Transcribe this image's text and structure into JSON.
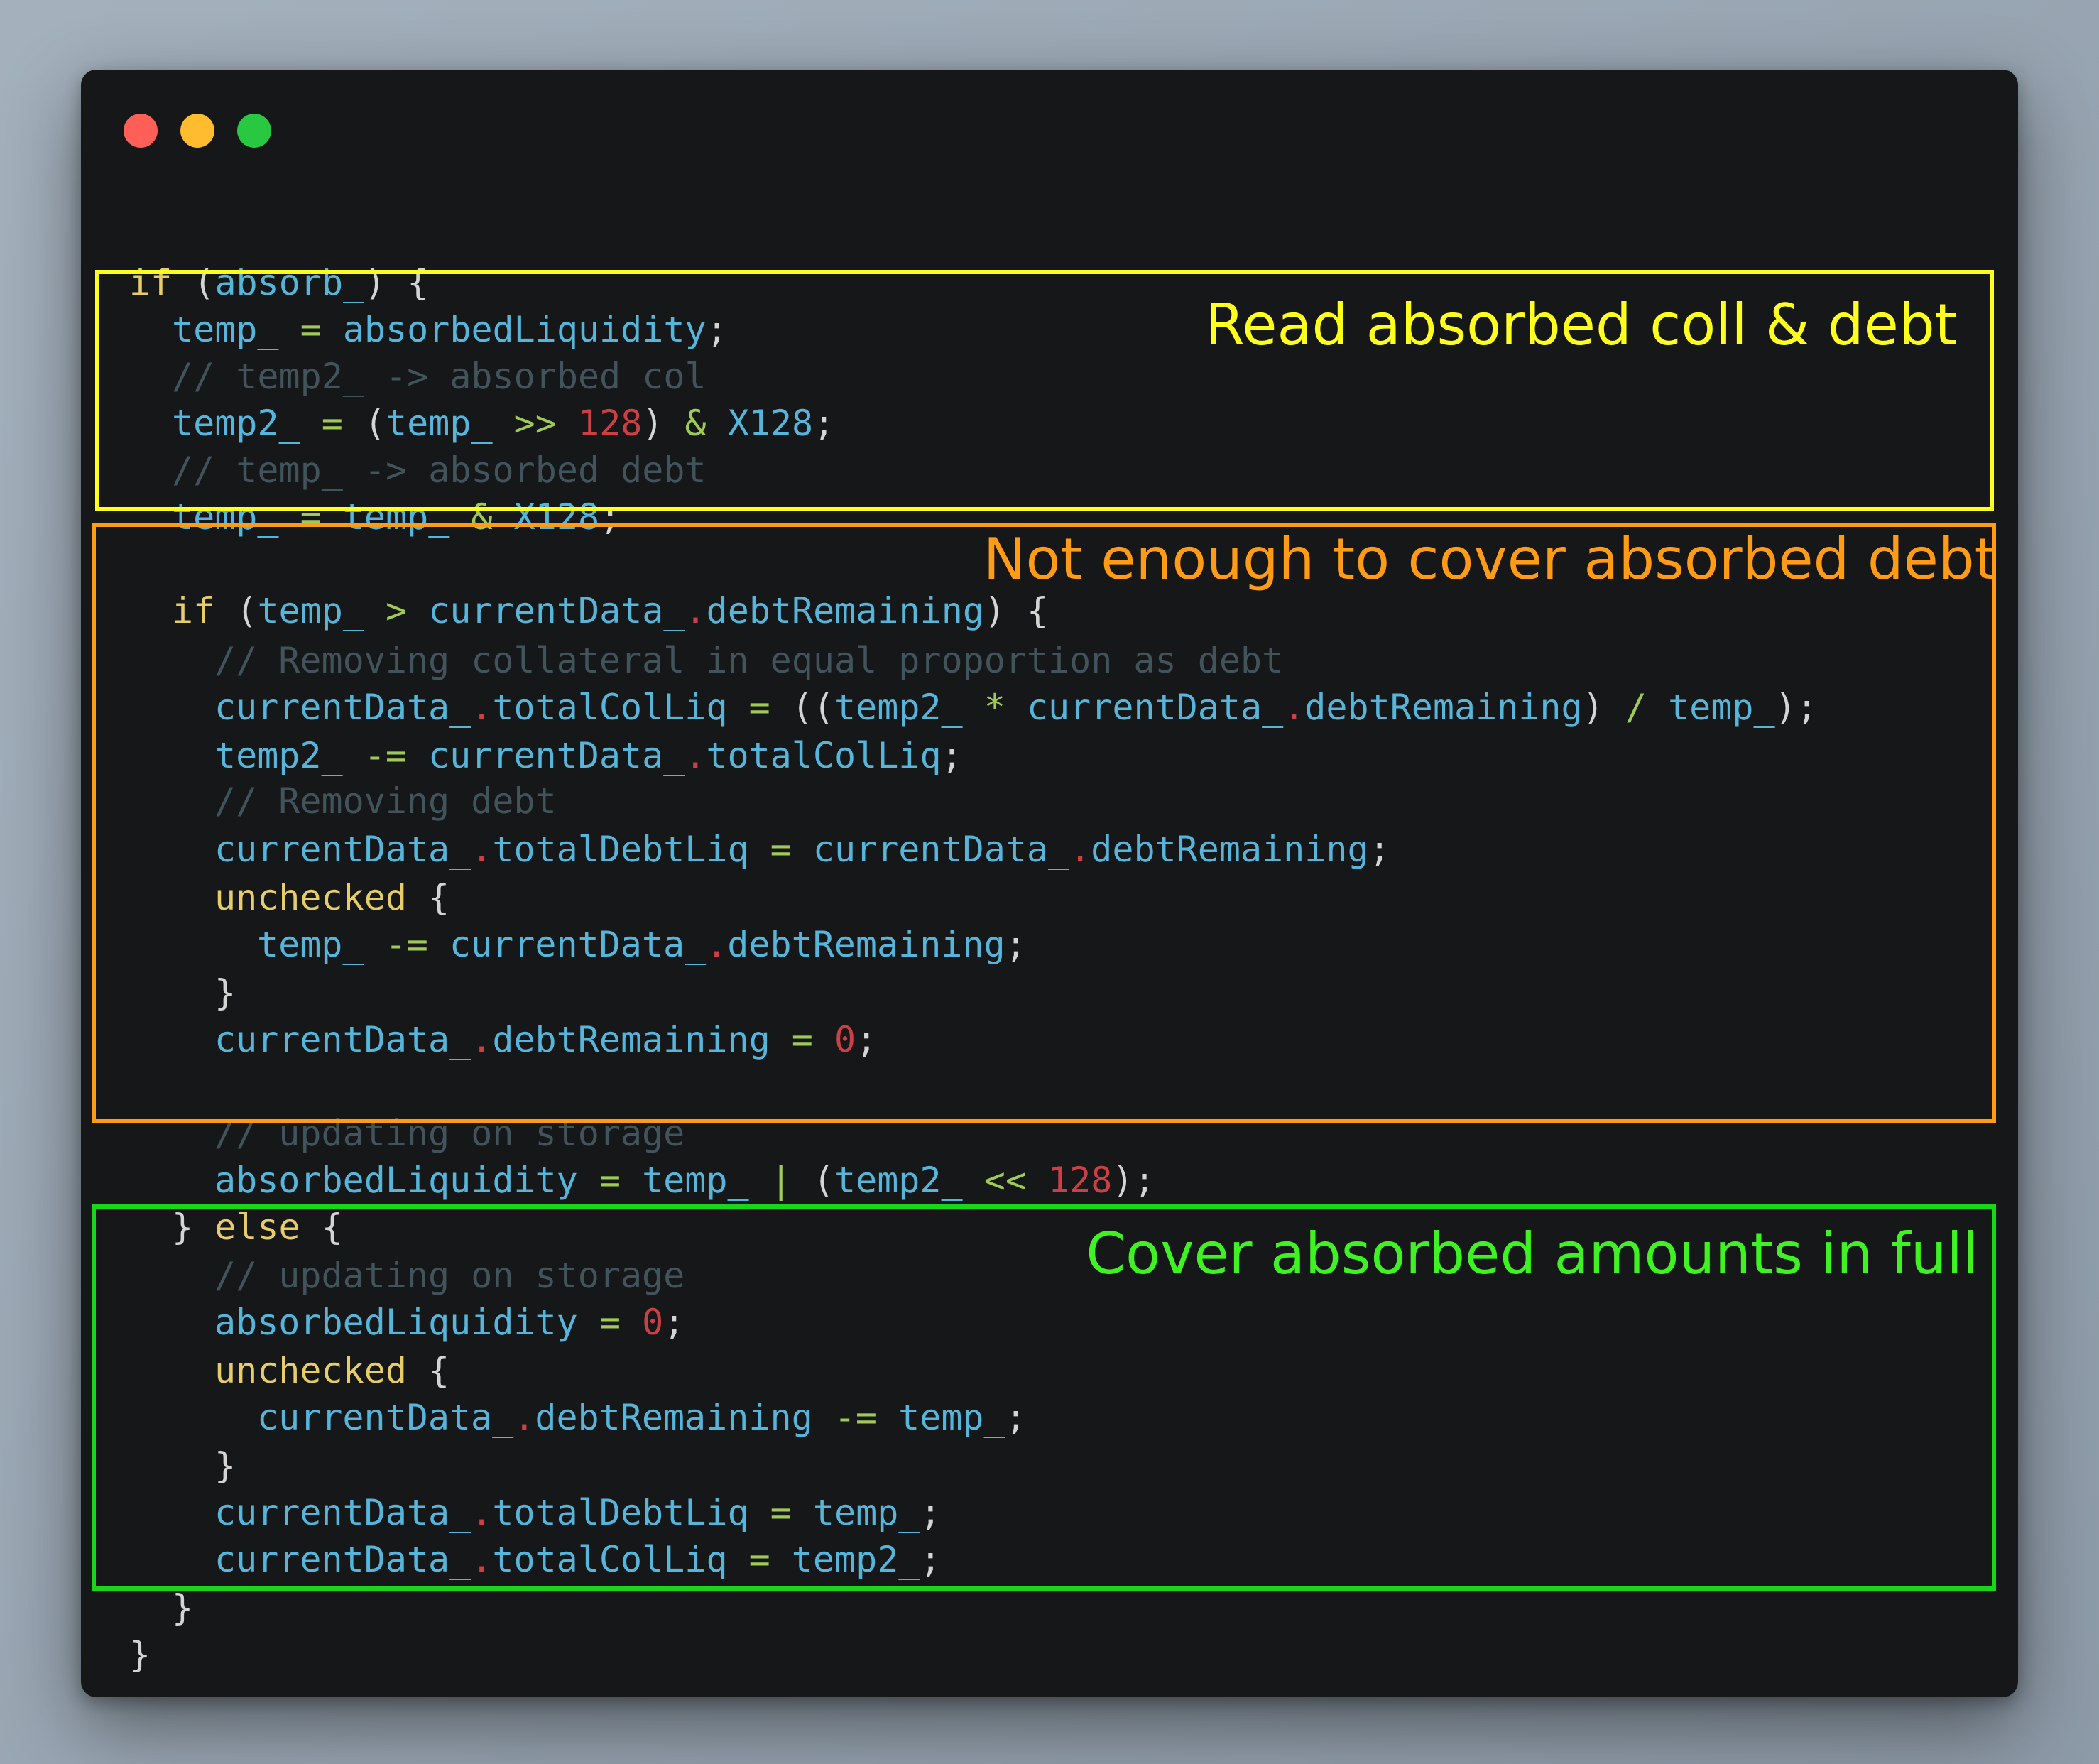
{
  "window": {
    "controls": [
      "close",
      "minimize",
      "maximize"
    ]
  },
  "code_lines": [
    {
      "indent": 0,
      "tokens": [
        [
          "kw",
          "if"
        ],
        [
          "pn",
          " ("
        ],
        [
          "id",
          "absorb_"
        ],
        [
          "pn",
          ") {"
        ]
      ]
    },
    {
      "indent": 1,
      "tokens": [
        [
          "id",
          "temp_"
        ],
        [
          "op",
          " = "
        ],
        [
          "id",
          "absorbedLiquidity"
        ],
        [
          "pn",
          ";"
        ]
      ]
    },
    {
      "indent": 1,
      "tokens": [
        [
          "cm",
          "// temp2_ -> absorbed col"
        ]
      ]
    },
    {
      "indent": 1,
      "tokens": [
        [
          "id",
          "temp2_"
        ],
        [
          "op",
          " = "
        ],
        [
          "pn",
          "("
        ],
        [
          "id",
          "temp_"
        ],
        [
          "op",
          " >> "
        ],
        [
          "num",
          "128"
        ],
        [
          "pn",
          ")"
        ],
        [
          "op",
          " & "
        ],
        [
          "id",
          "X128"
        ],
        [
          "pn",
          ";"
        ]
      ]
    },
    {
      "indent": 1,
      "tokens": [
        [
          "cm",
          "// temp_ -> absorbed debt"
        ]
      ]
    },
    {
      "indent": 1,
      "tokens": [
        [
          "id",
          "temp_"
        ],
        [
          "op",
          " = "
        ],
        [
          "id",
          "temp_"
        ],
        [
          "op",
          " & "
        ],
        [
          "id",
          "X128"
        ],
        [
          "pn",
          ";"
        ]
      ]
    },
    {
      "indent": 1,
      "tokens": [
        [
          "kw",
          "if"
        ],
        [
          "pn",
          " ("
        ],
        [
          "id",
          "temp_"
        ],
        [
          "op",
          " > "
        ],
        [
          "id",
          "currentData_"
        ],
        [
          "dotop",
          "."
        ],
        [
          "id",
          "debtRemaining"
        ],
        [
          "pn",
          ") {"
        ]
      ]
    },
    {
      "indent": 2,
      "tokens": [
        [
          "cm",
          "// Removing collateral in equal proportion as debt"
        ]
      ]
    },
    {
      "indent": 2,
      "tokens": [
        [
          "id",
          "currentData_"
        ],
        [
          "dotop",
          "."
        ],
        [
          "id",
          "totalColLiq"
        ],
        [
          "op",
          " = "
        ],
        [
          "pn",
          "(("
        ],
        [
          "id",
          "temp2_"
        ],
        [
          "op",
          " * "
        ],
        [
          "id",
          "currentData_"
        ],
        [
          "dotop",
          "."
        ],
        [
          "id",
          "debtRemaining"
        ],
        [
          "pn",
          ")"
        ],
        [
          "op",
          " / "
        ],
        [
          "id",
          "temp_"
        ],
        [
          "pn",
          ");"
        ]
      ]
    },
    {
      "indent": 2,
      "tokens": [
        [
          "id",
          "temp2_"
        ],
        [
          "op",
          " -= "
        ],
        [
          "id",
          "currentData_"
        ],
        [
          "dotop",
          "."
        ],
        [
          "id",
          "totalColLiq"
        ],
        [
          "pn",
          ";"
        ]
      ]
    },
    {
      "indent": 2,
      "tokens": [
        [
          "cm",
          "// Removing debt"
        ]
      ]
    },
    {
      "indent": 2,
      "tokens": [
        [
          "id",
          "currentData_"
        ],
        [
          "dotop",
          "."
        ],
        [
          "id",
          "totalDebtLiq"
        ],
        [
          "op",
          " = "
        ],
        [
          "id",
          "currentData_"
        ],
        [
          "dotop",
          "."
        ],
        [
          "id",
          "debtRemaining"
        ],
        [
          "pn",
          ";"
        ]
      ]
    },
    {
      "indent": 2,
      "tokens": [
        [
          "kw",
          "unchecked"
        ],
        [
          "pn",
          " {"
        ]
      ]
    },
    {
      "indent": 3,
      "tokens": [
        [
          "id",
          "temp_"
        ],
        [
          "op",
          " -= "
        ],
        [
          "id",
          "currentData_"
        ],
        [
          "dotop",
          "."
        ],
        [
          "id",
          "debtRemaining"
        ],
        [
          "pn",
          ";"
        ]
      ]
    },
    {
      "indent": 2,
      "tokens": [
        [
          "pn",
          "}"
        ]
      ]
    },
    {
      "indent": 2,
      "tokens": [
        [
          "id",
          "currentData_"
        ],
        [
          "dotop",
          "."
        ],
        [
          "id",
          "debtRemaining"
        ],
        [
          "op",
          " = "
        ],
        [
          "num",
          "0"
        ],
        [
          "pn",
          ";"
        ]
      ]
    },
    {
      "indent": 2,
      "tokens": [
        [
          "cm",
          "// updating on storage"
        ]
      ]
    },
    {
      "indent": 2,
      "tokens": [
        [
          "id",
          "absorbedLiquidity"
        ],
        [
          "op",
          " = "
        ],
        [
          "id",
          "temp_"
        ],
        [
          "op",
          " | "
        ],
        [
          "pn",
          "("
        ],
        [
          "id",
          "temp2_"
        ],
        [
          "op",
          " << "
        ],
        [
          "num",
          "128"
        ],
        [
          "pn",
          ");"
        ]
      ]
    },
    {
      "indent": 1,
      "tokens": [
        [
          "pn",
          "} "
        ],
        [
          "kw",
          "else"
        ],
        [
          "pn",
          " {"
        ]
      ]
    },
    {
      "indent": 2,
      "tokens": [
        [
          "cm",
          "// updating on storage"
        ]
      ]
    },
    {
      "indent": 2,
      "tokens": [
        [
          "id",
          "absorbedLiquidity"
        ],
        [
          "op",
          " = "
        ],
        [
          "num",
          "0"
        ],
        [
          "pn",
          ";"
        ]
      ]
    },
    {
      "indent": 2,
      "tokens": [
        [
          "kw",
          "unchecked"
        ],
        [
          "pn",
          " {"
        ]
      ]
    },
    {
      "indent": 3,
      "tokens": [
        [
          "id",
          "currentData_"
        ],
        [
          "dotop",
          "."
        ],
        [
          "id",
          "debtRemaining"
        ],
        [
          "op",
          " -= "
        ],
        [
          "id",
          "temp_"
        ],
        [
          "pn",
          ";"
        ]
      ]
    },
    {
      "indent": 2,
      "tokens": [
        [
          "pn",
          "}"
        ]
      ]
    },
    {
      "indent": 2,
      "tokens": [
        [
          "id",
          "currentData_"
        ],
        [
          "dotop",
          "."
        ],
        [
          "id",
          "totalDebtLiq"
        ],
        [
          "op",
          " = "
        ],
        [
          "id",
          "temp_"
        ],
        [
          "pn",
          ";"
        ]
      ]
    },
    {
      "indent": 2,
      "tokens": [
        [
          "id",
          "currentData_"
        ],
        [
          "dotop",
          "."
        ],
        [
          "id",
          "totalColLiq"
        ],
        [
          "op",
          " = "
        ],
        [
          "id",
          "temp2_"
        ],
        [
          "pn",
          ";"
        ]
      ]
    },
    {
      "indent": 1,
      "tokens": [
        [
          "pn",
          "}"
        ]
      ]
    },
    {
      "indent": 0,
      "tokens": [
        [
          "pn",
          "}"
        ]
      ]
    }
  ],
  "annotations": {
    "read": "Read absorbed coll & debt",
    "not_enough": "Not enough to cover absorbed debt",
    "cover": "Cover absorbed amounts in full"
  },
  "colors": {
    "read": "#ffff1e",
    "not_enough": "#ff9b14",
    "cover": "#3ef321"
  }
}
